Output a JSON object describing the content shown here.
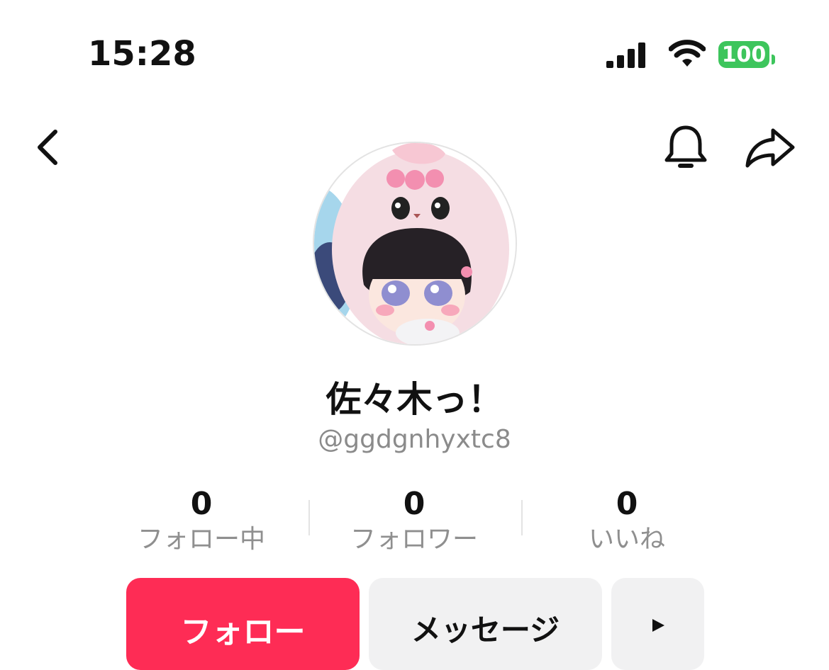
{
  "status_bar": {
    "time": "15:28",
    "battery": "100"
  },
  "colors": {
    "accent": "#fe2c55",
    "battery": "#3dc55c"
  },
  "nav": {
    "back_icon": "chevron-left-icon",
    "bell_icon": "bell-icon",
    "share_icon": "share-arrow-icon"
  },
  "profile": {
    "display_name": "佐々木っ！",
    "username": "@ggdgnhyxtc8"
  },
  "stats": [
    {
      "value": "0",
      "label": "フォロー中"
    },
    {
      "value": "0",
      "label": "フォロワー"
    },
    {
      "value": "0",
      "label": "いいね"
    }
  ],
  "actions": {
    "follow_label": "フォロー",
    "message_label": "メッセージ",
    "more_icon": "triangle-right-icon"
  }
}
